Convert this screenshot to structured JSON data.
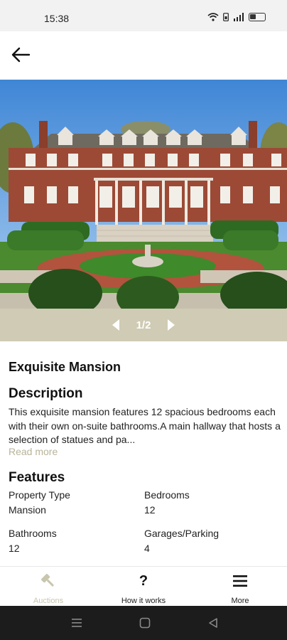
{
  "status_bar": {
    "time": "15:38",
    "icons": [
      "wifi-icon",
      "sim-icon",
      "signal-icon",
      "battery-icon"
    ]
  },
  "app_bar": {
    "back_icon": "arrow-left-icon"
  },
  "gallery": {
    "page_indicator": "1/2",
    "current": 1,
    "total": 2,
    "background_color": "#cfcbb4"
  },
  "property": {
    "title": "Exquisite Mansion",
    "description_heading": "Description",
    "description": "This exquisite mansion features 12 spacious bedrooms each with their own on-suite bathrooms.A main hallway that hosts a selection of statues and pa...",
    "read_more": "Read more",
    "features_heading": "Features",
    "features": [
      {
        "label": "Property Type",
        "value": "Mansion"
      },
      {
        "label": "Bedrooms",
        "value": "12"
      },
      {
        "label": "Bathrooms",
        "value": "12"
      },
      {
        "label": "Garages/Parking",
        "value": "4"
      }
    ]
  },
  "bottom_nav": {
    "items": [
      {
        "label": "Auctions",
        "icon": "gavel-icon",
        "active": true
      },
      {
        "label": "How it works",
        "icon": "question-icon",
        "active": false
      },
      {
        "label": "More",
        "icon": "menu-icon",
        "active": false
      }
    ],
    "active_color": "#c9c6ae"
  }
}
